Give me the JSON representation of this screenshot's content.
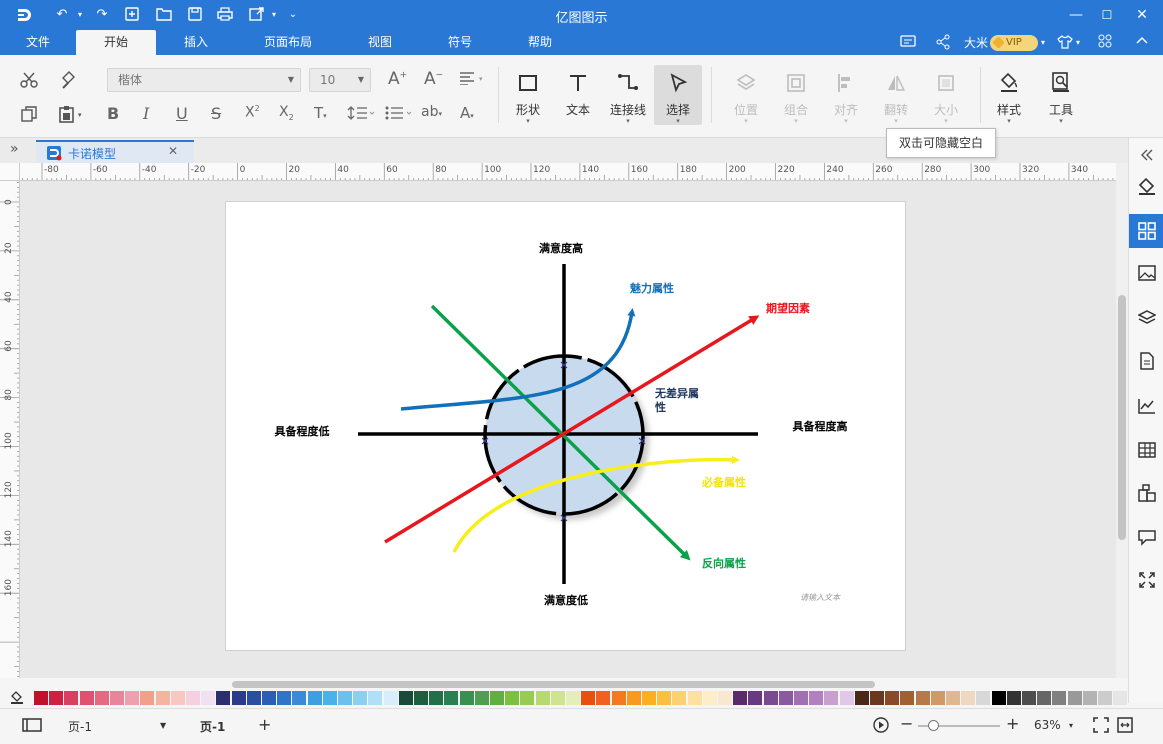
{
  "app": {
    "title": "亿图图示"
  },
  "menu": {
    "tabs": [
      "文件",
      "开始",
      "插入",
      "页面布局",
      "视图",
      "符号",
      "帮助"
    ],
    "active": "开始",
    "user": "大米",
    "vip": "VIP"
  },
  "ribbon": {
    "font_family": "楷体",
    "font_size": "10",
    "tools": {
      "shape": "形状",
      "text": "文本",
      "connector": "连接线",
      "select": "选择",
      "position": "位置",
      "group": "组合",
      "align": "对齐",
      "flip": "翻转",
      "size": "大小",
      "style": "样式",
      "tools": "工具"
    },
    "tooltip": "双击可隐藏空白"
  },
  "document": {
    "tab_title": "卡诺模型"
  },
  "rulers": {
    "h_ticks": [
      "-80",
      "-60",
      "-40",
      "-20",
      "0",
      "20",
      "40",
      "60",
      "80",
      "100",
      "120",
      "140",
      "160",
      "180",
      "200",
      "220",
      "240",
      "260",
      "280",
      "300",
      "320",
      "340",
      "360"
    ],
    "v_ticks": [
      "0",
      "20",
      "40",
      "60",
      "80",
      "100",
      "120",
      "140",
      "160"
    ]
  },
  "diagram": {
    "axis_top": "满意度高",
    "axis_bottom": "满意度低",
    "axis_left": "具备程度低",
    "axis_right": "具备程度高",
    "attr_attractive": "魅力属性",
    "attr_expected": "期望因素",
    "attr_indifferent_1": "无差异属",
    "attr_indifferent_2": "性",
    "attr_must_be": "必备属性",
    "attr_reverse": "反向属性",
    "placeholder_text": "请输入文本",
    "colors": {
      "attractive": "#1170b8",
      "expected": "#e8171d",
      "must_be": "#f7ee1a",
      "reverse": "#0aa14b",
      "circle_fill": "#c8dbee"
    }
  },
  "status": {
    "page_select": "页-1",
    "page_tab": "页-1",
    "zoom": "63%"
  },
  "palette": [
    "#c0102a",
    "#d02040",
    "#d84060",
    "#e05070",
    "#e36a80",
    "#e8859a",
    "#eea0b0",
    "#f2a08a",
    "#f5b4a0",
    "#f8c8c0",
    "#f6d0e0",
    "#f0e0f0",
    "#2c2f6e",
    "#2c3a8c",
    "#2b4fa0",
    "#2b5fb5",
    "#2f74c8",
    "#3a8ad8",
    "#3ca0e0",
    "#4ab2e8",
    "#6cc0ec",
    "#8cd0f0",
    "#b0e0f6",
    "#d8eefa",
    "#1a4a3a",
    "#1c6040",
    "#227048",
    "#2a8050",
    "#3a9050",
    "#4ea050",
    "#60b040",
    "#7cc040",
    "#98cc50",
    "#b8d870",
    "#d0e490",
    "#e4eeb8",
    "#e85010",
    "#f06020",
    "#f47a20",
    "#f89a20",
    "#fab020",
    "#fcc040",
    "#fdd070",
    "#fee0a0",
    "#fdeec8",
    "#f8e8d0",
    "#5a2a6a",
    "#6a3a80",
    "#7a4a90",
    "#8a5aa0",
    "#a070b0",
    "#b080c0",
    "#c8a0d0",
    "#e0c8e8",
    "#4a2818",
    "#6a3820",
    "#8a4a28",
    "#a06030",
    "#b87848",
    "#d09a68",
    "#e0b890",
    "#f0d8c0",
    "#d8d8d8",
    "#000000",
    "#333333",
    "#4d4d4d",
    "#666666",
    "#808080",
    "#999999",
    "#b3b3b3",
    "#cccccc",
    "#e6e6e6"
  ]
}
